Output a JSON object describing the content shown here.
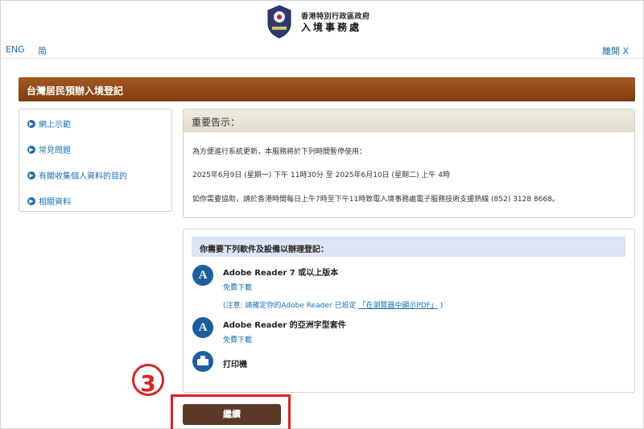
{
  "header": {
    "org_small": "香港特別行政區政府",
    "org_big": "入境事務處",
    "lang_eng": "ENG",
    "lang_simp": "简",
    "leave": "離開 X"
  },
  "banner": {
    "title": "台灣居民預辦入境登記"
  },
  "sidebar": {
    "items": [
      {
        "label": "網上示範"
      },
      {
        "label": "常見問題"
      },
      {
        "label": "有關收集個人資料的目的"
      },
      {
        "label": "相關資料"
      }
    ]
  },
  "notice": {
    "title": "重要告示：",
    "line1": "為方便進行系統更新，本服務將於下列時間暫停使用：",
    "line2": "2025年6月9日 (星期一) 下午 11時30分 至 2025年6月10日 (星期二) 上午 4時",
    "line3": "如你需要協助，請於香港時間每日上午7時至下午11時致電入境事務處電子服務技術支援熱線 (852) 3128 8668。"
  },
  "requirements": {
    "title": "你需要下列軟件及設備以辦理登記：",
    "items": [
      {
        "name": "Adobe Reader 7 或以上版本",
        "link": "免費下載",
        "note_prefix": "(注意: 請確定你的Adobe Reader 已設定",
        "note_link": "「在瀏覽器中顯示PDF」",
        "note_suffix": ")",
        "icon": "adobe-icon"
      },
      {
        "name": "Adobe Reader 的亞洲字型套件",
        "link": "免費下載",
        "icon": "adobe-icon"
      },
      {
        "name": "打印機",
        "icon": "printer-icon"
      }
    ]
  },
  "step": {
    "number": "3"
  },
  "continue_label": "繼續",
  "colors": {
    "banner": "#8b4515",
    "link": "#1a6fb5",
    "highlight": "#e02020",
    "button": "#5c3a28"
  }
}
